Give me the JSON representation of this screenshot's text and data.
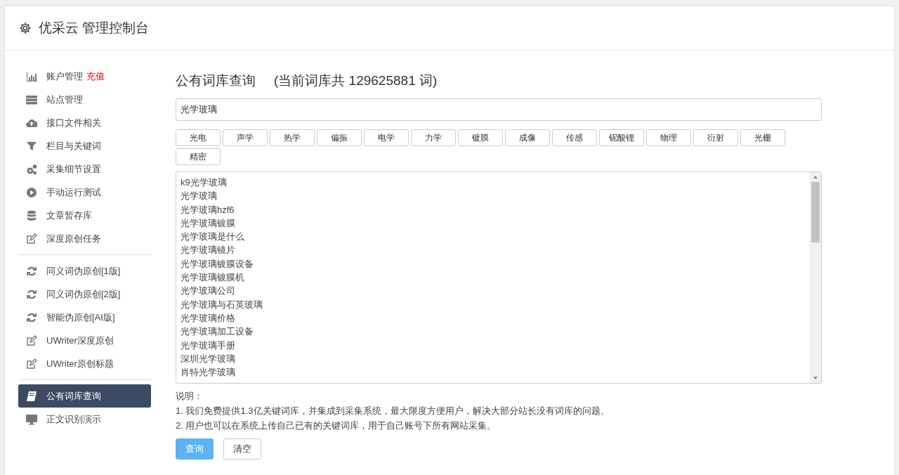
{
  "header": {
    "title": "优采云 管理控制台"
  },
  "sidebar": {
    "groups": [
      {
        "items": [
          {
            "label": "账户管理",
            "badge": "充值",
            "selected": false
          },
          {
            "label": "站点管理",
            "selected": false
          },
          {
            "label": "接口文件相关",
            "selected": false
          },
          {
            "label": "栏目与关键词",
            "selected": false
          },
          {
            "label": "采集细节设置",
            "selected": false
          },
          {
            "label": "手动运行测试",
            "selected": false
          },
          {
            "label": "文章暂存库",
            "selected": false
          },
          {
            "label": "深度原创任务",
            "selected": false
          }
        ]
      },
      {
        "items": [
          {
            "label": "同义词伪原创[1版]",
            "selected": false
          },
          {
            "label": "同义词伪原创[2版]",
            "selected": false
          },
          {
            "label": "智能伪原创[AI版]",
            "selected": false
          },
          {
            "label": "UWriter深度原创",
            "selected": false
          },
          {
            "label": "UWriter原创标题",
            "selected": false
          }
        ]
      },
      {
        "items": [
          {
            "label": "公有词库查询",
            "selected": true
          },
          {
            "label": "正文识别演示",
            "selected": false
          }
        ]
      }
    ]
  },
  "main": {
    "title": "公有词库查询",
    "count_text": "(当前词库共 129625881 词)",
    "search": {
      "value": "光学玻璃"
    },
    "tags": [
      "光电",
      "声学",
      "热学",
      "偏振",
      "电学",
      "力学",
      "镀膜",
      "成像",
      "传感",
      "铌酸锂",
      "物理",
      "衍射",
      "光栅",
      "精密"
    ],
    "results": [
      "k9光学玻璃",
      "光学玻璃",
      "光学玻璃hzf6",
      "光学玻璃镀膜",
      "光学玻璃是什么",
      "光学玻璃镜片",
      "光学玻璃镀膜设备",
      "光学玻璃镀膜机",
      "光学玻璃公司",
      "光学玻璃与石英玻璃",
      "光学玻璃价格",
      "光学玻璃加工设备",
      "光学玻璃手册",
      "深圳光学玻璃",
      "肖特光学玻璃"
    ],
    "notes_title": "说明：",
    "notes": [
      "1. 我们免费提供1.3亿关键词库，并集成到采集系统，最大限度方便用户，解决大部分站长没有词库的问题。",
      "2. 用户也可以在系统上传自己已有的关键词库，用于自己账号下所有网站采集。"
    ],
    "buttons": [
      {
        "label": "查询",
        "kind": "primary"
      },
      {
        "label": "清空",
        "kind": "default"
      }
    ]
  }
}
